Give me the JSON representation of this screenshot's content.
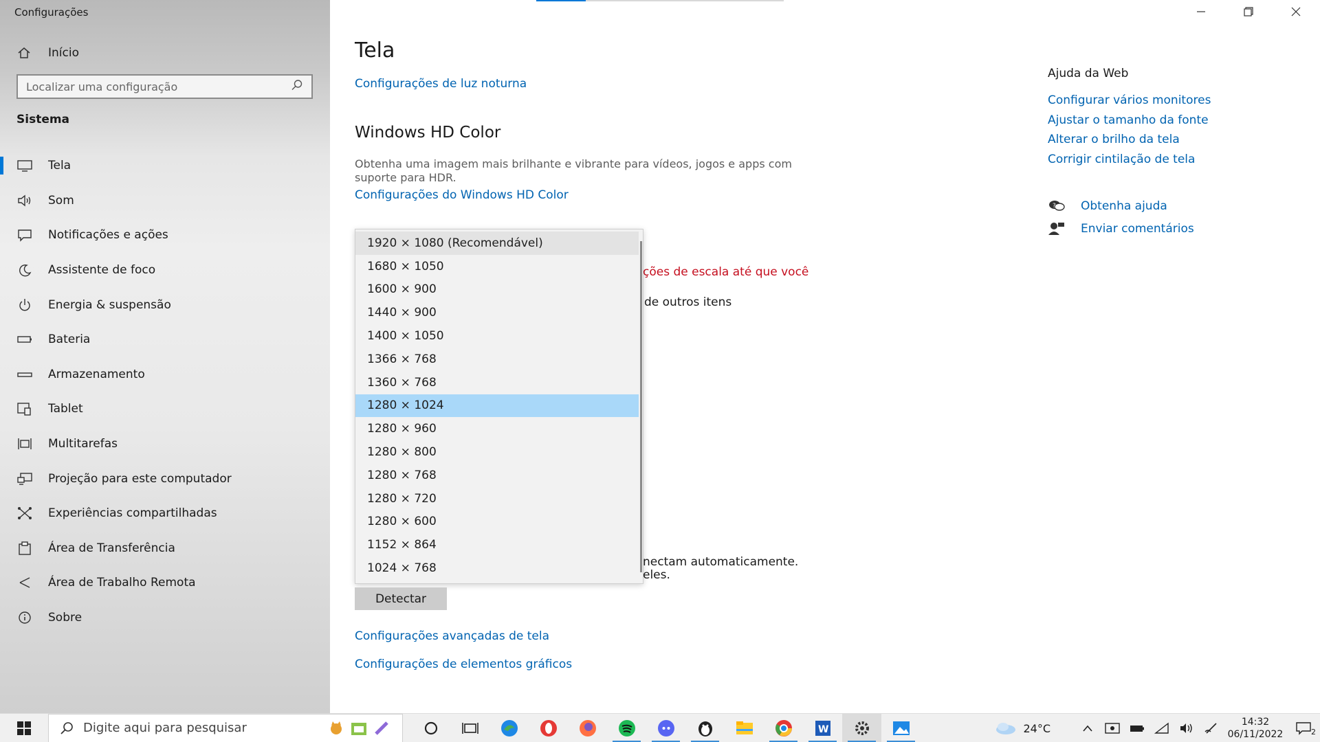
{
  "app": {
    "title": "Configurações"
  },
  "sidebar": {
    "home_label": "Início",
    "search_placeholder": "Localizar uma configuração",
    "section": "Sistema",
    "items": [
      {
        "label": "Tela",
        "icon": "monitor-icon"
      },
      {
        "label": "Som",
        "icon": "speaker-icon"
      },
      {
        "label": "Notificações e ações",
        "icon": "notification-icon"
      },
      {
        "label": "Assistente de foco",
        "icon": "moon-icon"
      },
      {
        "label": "Energia & suspensão",
        "icon": "power-icon"
      },
      {
        "label": "Bateria",
        "icon": "battery-icon"
      },
      {
        "label": "Armazenamento",
        "icon": "storage-icon"
      },
      {
        "label": "Tablet",
        "icon": "tablet-icon"
      },
      {
        "label": "Multitarefas",
        "icon": "multitask-icon"
      },
      {
        "label": "Projeção para este computador",
        "icon": "projection-icon"
      },
      {
        "label": "Experiências compartilhadas",
        "icon": "shared-icon"
      },
      {
        "label": "Área de Transferência",
        "icon": "clipboard-icon"
      },
      {
        "label": "Área de Trabalho Remota",
        "icon": "remote-desktop-icon"
      },
      {
        "label": "Sobre",
        "icon": "info-icon"
      }
    ]
  },
  "main": {
    "title": "Tela",
    "night_light_link": "Configurações de luz noturna",
    "hdr_heading": "Windows HD Color",
    "hdr_desc": "Obtenha uma imagem mais brilhante e vibrante para vídeos, jogos e apps com suporte para HDR.",
    "hdr_link": "Configurações do Windows HD Color",
    "partial_scale_warning": "ções de escala até que você",
    "partial_other_items": "de outros itens",
    "partial_connect_1": "nectam automaticamente.",
    "partial_connect_2": "eles.",
    "detect_button": "Detectar",
    "advanced_link": "Configurações avançadas de tela",
    "graphics_link": "Configurações de elementos gráficos"
  },
  "resolution_dropdown": {
    "selected": "1280 × 1024",
    "options": [
      "1920 × 1080 (Recomendável)",
      "1680 × 1050",
      "1600 × 900",
      "1440 × 900",
      "1400 × 1050",
      "1366 × 768",
      "1360 × 768",
      "1280 × 1024",
      "1280 × 960",
      "1280 × 800",
      "1280 × 768",
      "1280 × 720",
      "1280 × 600",
      "1152 × 864",
      "1024 × 768"
    ]
  },
  "help": {
    "title": "Ajuda da Web",
    "links": [
      "Configurar vários monitores",
      "Ajustar o tamanho da fonte",
      "Alterar o brilho da tela",
      "Corrigir cintilação de tela"
    ],
    "get_help": "Obtenha ajuda",
    "feedback": "Enviar comentários"
  },
  "taskbar": {
    "search_placeholder": "Digite aqui para pesquisar",
    "weather": "24°C",
    "time": "14:32",
    "date": "06/11/2022",
    "notification_count": "2"
  },
  "colors": {
    "accent": "#0078d7",
    "link": "#0063b1",
    "warning": "#c50f1f",
    "selected": "#a9d8f9"
  }
}
